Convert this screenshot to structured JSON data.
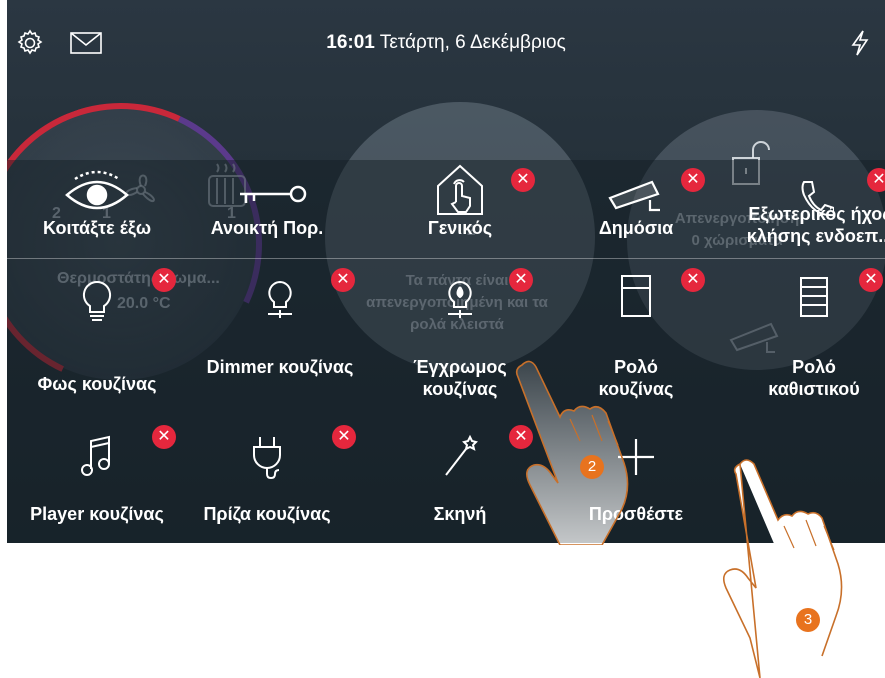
{
  "topbar": {
    "time": "16:01",
    "date": "Τετάρτη, 6 Δεκέμβριος",
    "icons": [
      "gear-icon",
      "mail-icon",
      "lightning-icon"
    ]
  },
  "background": {
    "thermo_title": "Θερμοστάτης δωμα...",
    "thermo_temp": "20.0 °C",
    "thermo_val_a": "2",
    "thermo_val_b": "1",
    "thermo_val_c": "1",
    "center_text": "Τα πάντα είναι απενεργοποιημένη και τα ρολά κλειστά",
    "center_num": "2",
    "right_text": "Απενεργοποίηση",
    "right_sub": "0 χώρισματα"
  },
  "tiles": [
    {
      "label": "Κοιτάξτε έξω",
      "icon": "eye-icon",
      "deletable": false
    },
    {
      "label": "Ανοικτή Πορ.",
      "icon": "key-icon",
      "deletable": false
    },
    {
      "label": "Γενικός",
      "icon": "house-touch-icon",
      "deletable": true
    },
    {
      "label": "Δημόσια",
      "icon": "camera-icon",
      "deletable": true
    },
    {
      "label": "Εξωτερικός ήχος κλήσης ενδοεπ...",
      "icon": "phone-icon",
      "deletable": true
    },
    {
      "label": "Φως κουζίνας",
      "icon": "bulb-icon",
      "deletable": true
    },
    {
      "label": "Dimmer κουζίνας",
      "icon": "dimmer-bulb-icon",
      "deletable": true
    },
    {
      "label": "Έγχρωμος κουζίνας",
      "icon": "color-bulb-icon",
      "deletable": true
    },
    {
      "label": "Ρολό κουζίνας",
      "icon": "shutter-icon",
      "deletable": true
    },
    {
      "label": "Ρολό καθιστικού",
      "icon": "blind-icon",
      "deletable": true
    },
    {
      "label": "Player κουζίνας",
      "icon": "music-note-icon",
      "deletable": true
    },
    {
      "label": "Πρίζα κουζίνας",
      "icon": "plug-icon",
      "deletable": true
    },
    {
      "label": "Σκηνή",
      "icon": "magic-wand-icon",
      "deletable": true
    },
    {
      "label": "Προσθέστε",
      "icon": "plus-icon",
      "deletable": false
    }
  ],
  "step_badges": [
    "2",
    "3"
  ],
  "colors": {
    "delete": "#e5273d",
    "badge": "#e8731e",
    "ring_red": "#c9283a"
  }
}
